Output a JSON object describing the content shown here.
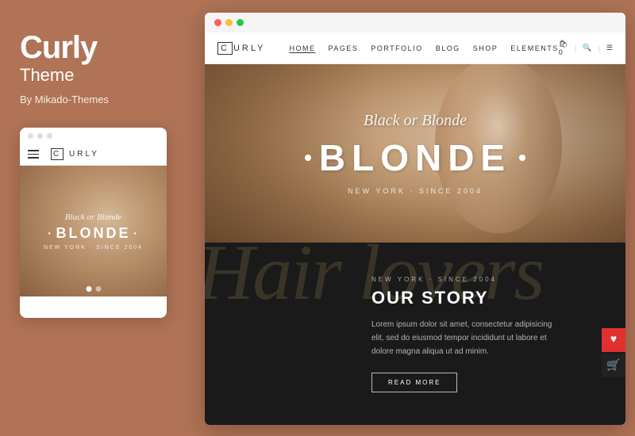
{
  "leftPanel": {
    "title": "Curly",
    "subtitle": "Theme",
    "byLine": "By Mikado-Themes"
  },
  "mobilePreview": {
    "logoText": "URLY",
    "heroScript": "Black or Blonde",
    "heroTitle": "BLONDE",
    "heroSub": "NEW YORK · SINCE 2004"
  },
  "desktopPreview": {
    "logoText": "URLY",
    "nav": {
      "links": [
        "HOME",
        "PAGES",
        "PORTFOLIO",
        "BLOG",
        "SHOP",
        "ELEMENTS"
      ],
      "activeIndex": 0
    },
    "hero": {
      "scriptText": "Black or Blonde",
      "mainTitle": "BLONDE",
      "subText": "NEW YORK · SINCE 2004"
    },
    "story": {
      "bgScript": "Hair lovers",
      "eyebrow": "NEW YORK · SINCE 2004",
      "title": "OUR STORY",
      "body": "Lorem ipsum dolor sit amet, consectetur adipisicing elit, sed do eiusmod tempor incididunt ut labore et dolore magna aliqua ut ad minim.",
      "buttonLabel": "READ MORE"
    }
  }
}
